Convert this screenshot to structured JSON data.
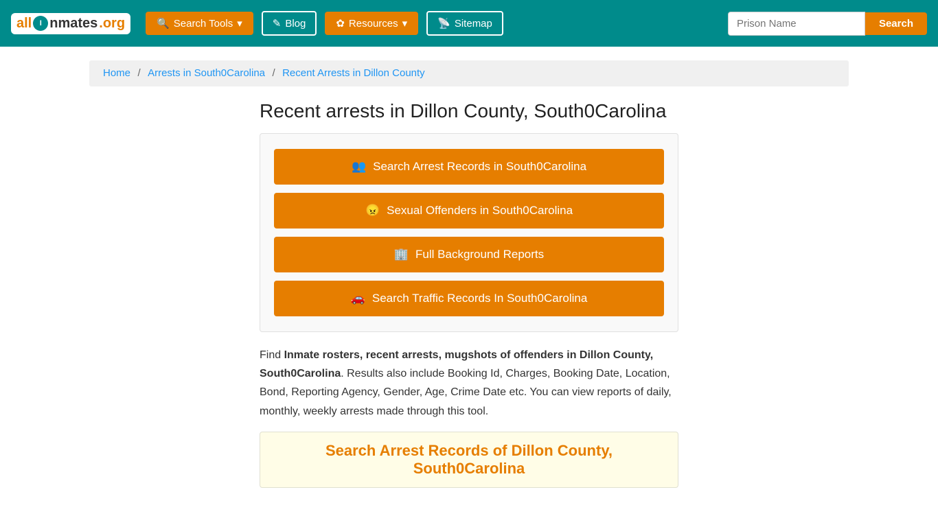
{
  "logo": {
    "text_all": "all",
    "text_inmates": "Inmates",
    "text_org": ".org"
  },
  "nav": {
    "search_tools_label": "Search Tools",
    "blog_label": "Blog",
    "resources_label": "Resources",
    "sitemap_label": "Sitemap",
    "prison_name_placeholder": "Prison Name",
    "search_button_label": "Search"
  },
  "breadcrumb": {
    "home": "Home",
    "arrests": "Arrests in South0Carolina",
    "current": "Recent Arrests in Dillon County"
  },
  "page": {
    "title": "Recent arrests in Dillon County, South0Carolina",
    "buttons": [
      {
        "id": "btn-arrest",
        "icon": "👥",
        "label": "Search Arrest Records in South0Carolina"
      },
      {
        "id": "btn-offenders",
        "icon": "😠",
        "label": "Sexual Offenders in South0Carolina"
      },
      {
        "id": "btn-background",
        "icon": "🏢",
        "label": "Full Background Reports"
      },
      {
        "id": "btn-traffic",
        "icon": "🚗",
        "label": "Search Traffic Records In South0Carolina"
      }
    ],
    "description_prefix": "Find ",
    "description_bold": "Inmate rosters, recent arrests, mugshots of offenders in Dillon County, South0Carolina",
    "description_suffix": ". Results also include Booking Id, Charges, Booking Date, Location, Bond, Reporting Agency, Gender, Age, Crime Date etc. You can view reports of daily, monthly, weekly arrests made through this tool.",
    "section_title": "Search Arrest Records of Dillon County, South0Carolina"
  }
}
